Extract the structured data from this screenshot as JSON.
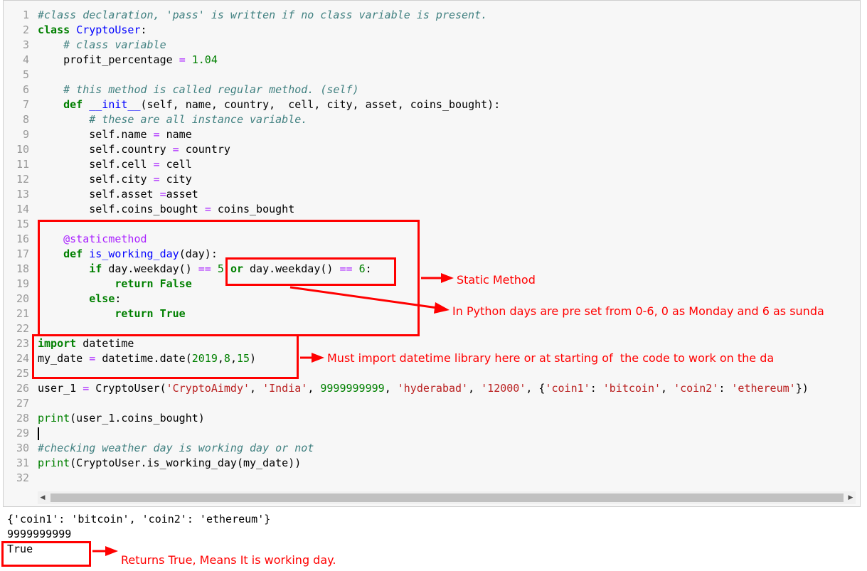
{
  "code": {
    "lines": [
      {
        "n": "1"
      },
      {
        "n": "2"
      },
      {
        "n": "3"
      },
      {
        "n": "4"
      },
      {
        "n": "5"
      },
      {
        "n": "6"
      },
      {
        "n": "7"
      },
      {
        "n": "8"
      },
      {
        "n": "9"
      },
      {
        "n": "10"
      },
      {
        "n": "11"
      },
      {
        "n": "12"
      },
      {
        "n": "13"
      },
      {
        "n": "14"
      },
      {
        "n": "15"
      },
      {
        "n": "16"
      },
      {
        "n": "17"
      },
      {
        "n": "18"
      },
      {
        "n": "19"
      },
      {
        "n": "20"
      },
      {
        "n": "21"
      },
      {
        "n": "22"
      },
      {
        "n": "23"
      },
      {
        "n": "24"
      },
      {
        "n": "25"
      },
      {
        "n": "26"
      },
      {
        "n": "27"
      },
      {
        "n": "28"
      },
      {
        "n": "29"
      },
      {
        "n": "30"
      },
      {
        "n": "31"
      },
      {
        "n": "32"
      }
    ],
    "l1": "#class declaration, 'pass' is written if no class variable is present.",
    "l2_kw": "class",
    "l2_name": "CryptoUser",
    "l2_rest": ":",
    "l3": "# class variable",
    "l4_a": "profit_percentage",
    "l4_op": "=",
    "l4_num": "1.04",
    "l6": "# this method is called regular method. (self)",
    "l7_kw": "def",
    "l7_fn": "__init__",
    "l7_rest": "(self, name, country,  cell, city, asset, coins_bought):",
    "l8": "# these are all instance variable.",
    "l9_a": "self.name",
    "l9_op": "=",
    "l9_b": "name",
    "l10_a": "self.country",
    "l10_op": "=",
    "l10_b": "country",
    "l11_a": "self.cell",
    "l11_op": "=",
    "l11_b": "cell",
    "l12_a": "self.city",
    "l12_op": "=",
    "l12_b": "city",
    "l13_a": "self.asset",
    "l13_op": "=",
    "l13_b": "asset",
    "l14_a": "self.coins_bought",
    "l14_op": "=",
    "l14_b": "coins_bought",
    "l16": "@staticmethod",
    "l17_kw": "def",
    "l17_fn": "is_working_day",
    "l17_rest": "(day):",
    "l18_kw": "if",
    "l18_a": "day.weekday()",
    "l18_op1": "==",
    "l18_n1": "5",
    "l18_or": "or",
    "l18_b": "day.weekday()",
    "l18_op2": "==",
    "l18_n2": "6",
    "l18_end": ":",
    "l19_kw": "return",
    "l19_val": "False",
    "l20_kw": "else",
    "l20_end": ":",
    "l21_kw": "return",
    "l21_val": "True",
    "l23_kw": "import",
    "l23_rest": "datetime",
    "l24_a": "my_date",
    "l24_op": "=",
    "l24_b": "datetime.date(",
    "l24_n1": "2019",
    "l24_n2": "8",
    "l24_n3": "15",
    "l24_end": ")",
    "l26_a": "user_1",
    "l26_op": "=",
    "l26_b": "CryptoUser(",
    "l26_s1": "'CryptoAimdy'",
    "l26_s2": "'India'",
    "l26_n": "9999999999",
    "l26_s3": "'hyderabad'",
    "l26_s4": "'12000'",
    "l26_s5": "'coin1'",
    "l26_s6": "'bitcoin'",
    "l26_s7": "'coin2'",
    "l26_s8": "'ethereum'",
    "l28_fn": "print",
    "l28_rest": "(user_1.coins_bought)",
    "l30": "#checking weather day is working day or not",
    "l31_fn": "print",
    "l31_rest": "(CryptoUser.is_working_day(my_date))"
  },
  "output": {
    "line1": "{'coin1': 'bitcoin', 'coin2': 'ethereum'}",
    "line2": "9999999999",
    "line3": "True"
  },
  "annotations": {
    "static_method": "Static Method",
    "days": "In Python days are pre set from 0-6, 0 as Monday and 6 as sunda",
    "import_note": "Must import datetime library here or at starting of  the code to work on the da",
    "returns": "Returns True, Means It is working day."
  },
  "colors": {
    "annotation": "#ff0000",
    "keyword": "#008000",
    "comment": "#408080",
    "operator": "#aa22ff",
    "string": "#ba2121",
    "function": "#0000ff"
  },
  "icons": {
    "scroll_left": "chevron-left-icon",
    "scroll_right": "chevron-right-icon"
  }
}
